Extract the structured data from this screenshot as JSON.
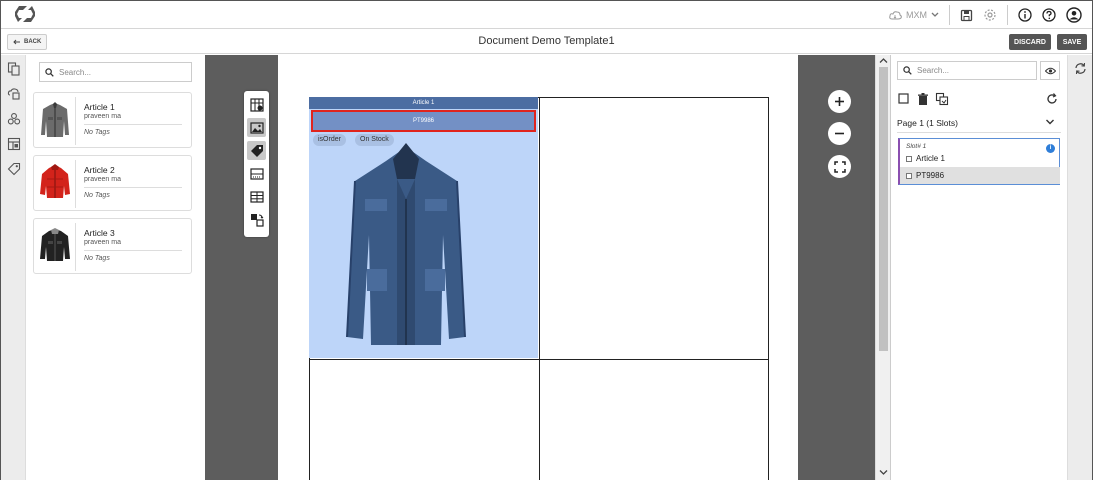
{
  "topbar": {
    "user": "MXM"
  },
  "subbar": {
    "back_label": "BACK",
    "title": "Document Demo Template1",
    "discard_label": "DISCARD",
    "save_label": "SAVE"
  },
  "left_panel": {
    "search_placeholder": "Search...",
    "articles": [
      {
        "title": "Article 1",
        "owner": "praveen ma",
        "tags": "No Tags",
        "color": "gray"
      },
      {
        "title": "Article 2",
        "owner": "praveen ma",
        "tags": "No Tags",
        "color": "red"
      },
      {
        "title": "Article 3",
        "owner": "praveen ma",
        "tags": "No Tags",
        "color": "black"
      }
    ]
  },
  "canvas": {
    "slot_header": "Article 1",
    "slot_selected": "PT9986",
    "chips": [
      "isOrder",
      "On Stock"
    ]
  },
  "right_panel": {
    "search_placeholder": "Search...",
    "page_label": "Page 1 (1 Slots)",
    "slot_label": "Slot# 1",
    "tree_article": "Article 1",
    "tree_item": "PT9986"
  },
  "colors": {
    "slot_bg": "#bdd5f9",
    "slot_header": "#4c6da2",
    "selection": "#e0241d",
    "button_dark": "#555555",
    "canvas_bg": "#5d5d5d"
  }
}
